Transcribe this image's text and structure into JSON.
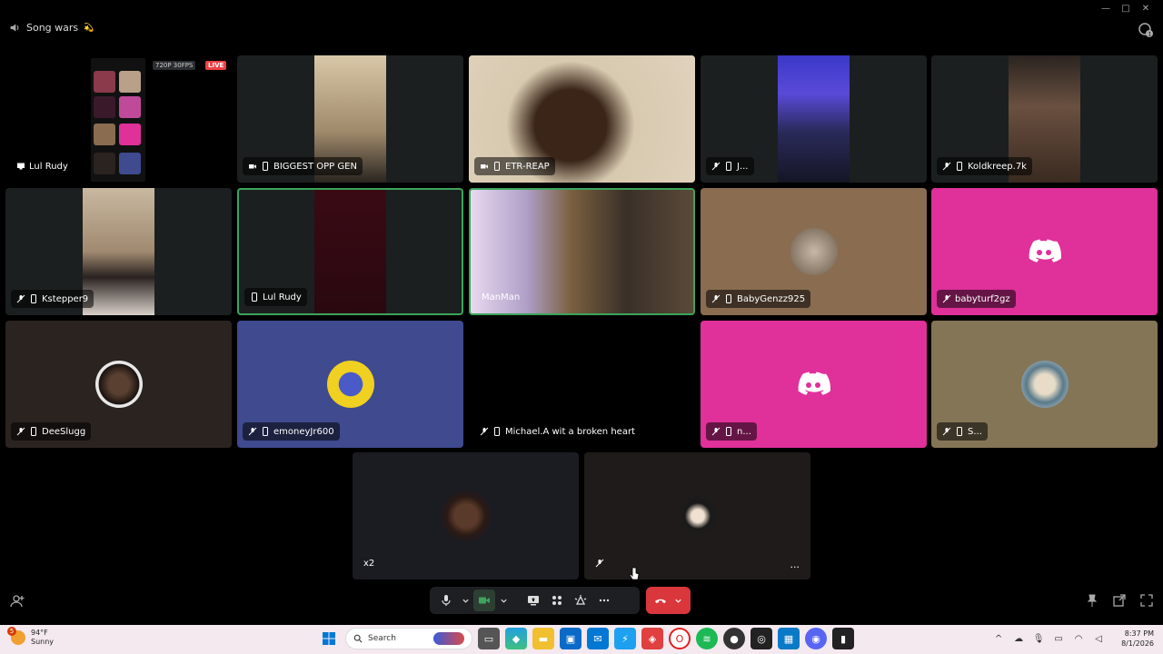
{
  "header": {
    "channel_name": "Song wars",
    "channel_emoji": "💫"
  },
  "stream": {
    "quality": "720P 30FPS",
    "live": "LIVE"
  },
  "tiles": [
    {
      "name": "Lul Rudy",
      "bg": "#000000",
      "kind": "stream"
    },
    {
      "name": "BIGGEST OPP GEN",
      "bg": "#1c1f20",
      "kind": "video"
    },
    {
      "name": "ETR-REAP",
      "bg": "#b8a089",
      "kind": "video"
    },
    {
      "name": "J...",
      "bg": "#1c1f20",
      "kind": "video"
    },
    {
      "name": "Koldkreep.7k",
      "bg": "#1c1f20",
      "kind": "video"
    },
    {
      "name": "Kstepper9",
      "bg": "#1c1f20",
      "kind": "video"
    },
    {
      "name": "Lul Rudy",
      "bg": "#1c1f20",
      "kind": "video"
    },
    {
      "name": "ManMan",
      "bg": "#2a3038",
      "kind": "video"
    },
    {
      "name": "BabyGenzz925",
      "bg": "#8a6c50",
      "kind": "avatar"
    },
    {
      "name": "babyturf2gz",
      "bg": "#e0309a",
      "kind": "discord"
    },
    {
      "name": "DeeSlugg",
      "bg": "#2a2320",
      "kind": "avatar"
    },
    {
      "name": "emoneyJr600",
      "bg": "#3f4a8f",
      "kind": "avatar"
    },
    {
      "name": "Michael.A wit a broken heart",
      "bg": "#000000",
      "kind": "video"
    },
    {
      "name": "n...",
      "bg": "#e0309a",
      "kind": "discord"
    },
    {
      "name": "S...",
      "bg": "#847557",
      "kind": "avatar"
    },
    {
      "name": "x2",
      "bg": "#1b1b22",
      "kind": "avatar"
    },
    {
      "name": "",
      "bg": "#1f1b1b",
      "kind": "avatar"
    }
  ],
  "more_label": "...",
  "taskbar": {
    "temperature": "94°F",
    "condition": "Sunny",
    "weather_badge": "5",
    "search_placeholder": "Search",
    "time": "8:37 PM",
    "date": "8/1/2026"
  },
  "colors": {
    "speaking_border": "#3ba55c",
    "hangup": "#da373c",
    "discord_pink": "#e0309a"
  }
}
